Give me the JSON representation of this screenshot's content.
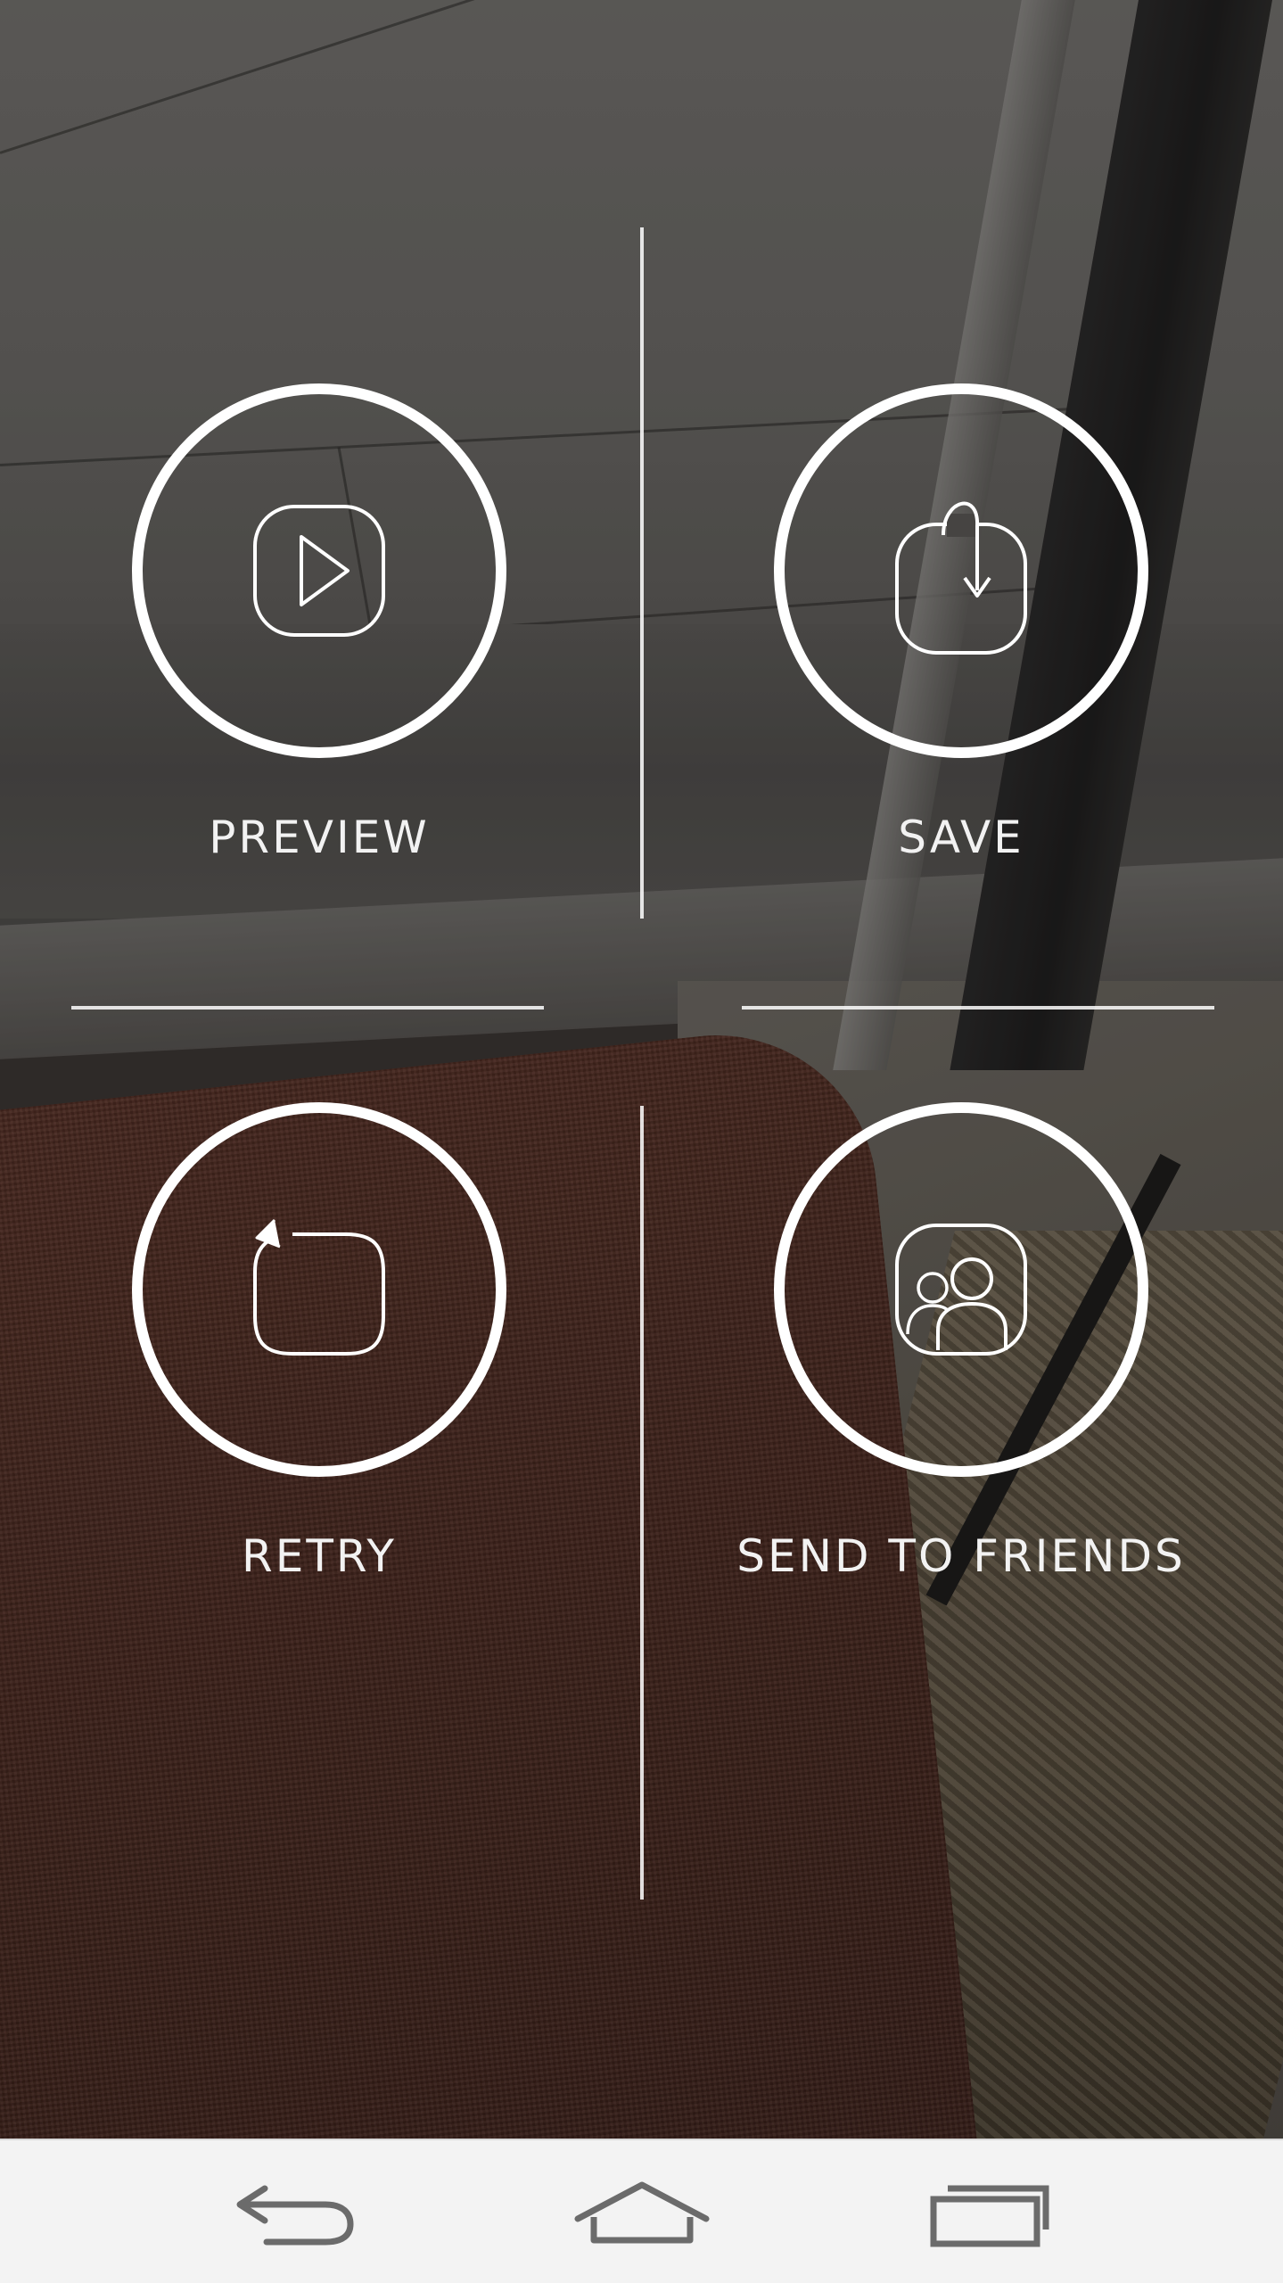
{
  "actions": {
    "preview": {
      "label": "PREVIEW",
      "icon": "play-icon"
    },
    "save": {
      "label": "SAVE",
      "icon": "save-download-icon"
    },
    "retry": {
      "label": "RETRY",
      "icon": "retry-icon"
    },
    "send": {
      "label": "SEND TO FRIENDS",
      "icon": "friends-icon"
    }
  },
  "navigation": {
    "back": "back-icon",
    "home": "home-icon",
    "recents": "recent-apps-icon"
  },
  "colors": {
    "ring": "#ffffff",
    "label": "#f2f2f2",
    "navbar": "#f3f3f3",
    "nav_icon": "#6b6b6b"
  }
}
